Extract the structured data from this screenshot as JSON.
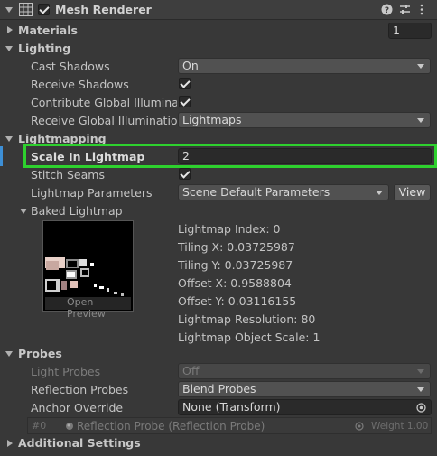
{
  "component": {
    "title": "Mesh Renderer",
    "enabled": true
  },
  "materials": {
    "label": "Materials",
    "count": "1"
  },
  "lighting": {
    "section": "Lighting",
    "cast_shadows_label": "Cast Shadows",
    "cast_shadows_value": "On",
    "receive_shadows_label": "Receive Shadows",
    "receive_shadows_checked": true,
    "contribute_gi_label": "Contribute Global Illumination",
    "contribute_gi_checked": true,
    "receive_gi_label": "Receive Global Illumination",
    "receive_gi_value": "Lightmaps"
  },
  "lightmapping": {
    "section": "Lightmapping",
    "scale_label": "Scale In Lightmap",
    "scale_value": "2",
    "stitch_seams_label": "Stitch Seams",
    "stitch_seams_checked": true,
    "params_label": "Lightmap Parameters",
    "params_value": "Scene Default Parameters",
    "view_button": "View",
    "baked_label": "Baked Lightmap",
    "open_preview": "Open Preview",
    "info": [
      "Lightmap Index: 0",
      "Tiling X: 0.03725987",
      "Tiling Y: 0.03725987",
      "Offset X: 0.9588804",
      "Offset Y: 0.03116155",
      "Lightmap Resolution: 80",
      "Lightmap Object Scale: 1"
    ]
  },
  "probes": {
    "section": "Probes",
    "light_probes_label": "Light Probes",
    "light_probes_value": "Off",
    "reflection_probes_label": "Reflection Probes",
    "reflection_probes_value": "Blend Probes",
    "anchor_label": "Anchor Override",
    "anchor_value": "None (Transform)",
    "probe_index": "#0",
    "probe_name": "Reflection Probe (Reflection Probe)",
    "probe_weight": "Weight 1.00"
  },
  "additional": {
    "section": "Additional Settings"
  },
  "colors": {
    "background": "#383838",
    "highlight": "#2ed12e",
    "selection_bar": "#3d8fd6"
  }
}
